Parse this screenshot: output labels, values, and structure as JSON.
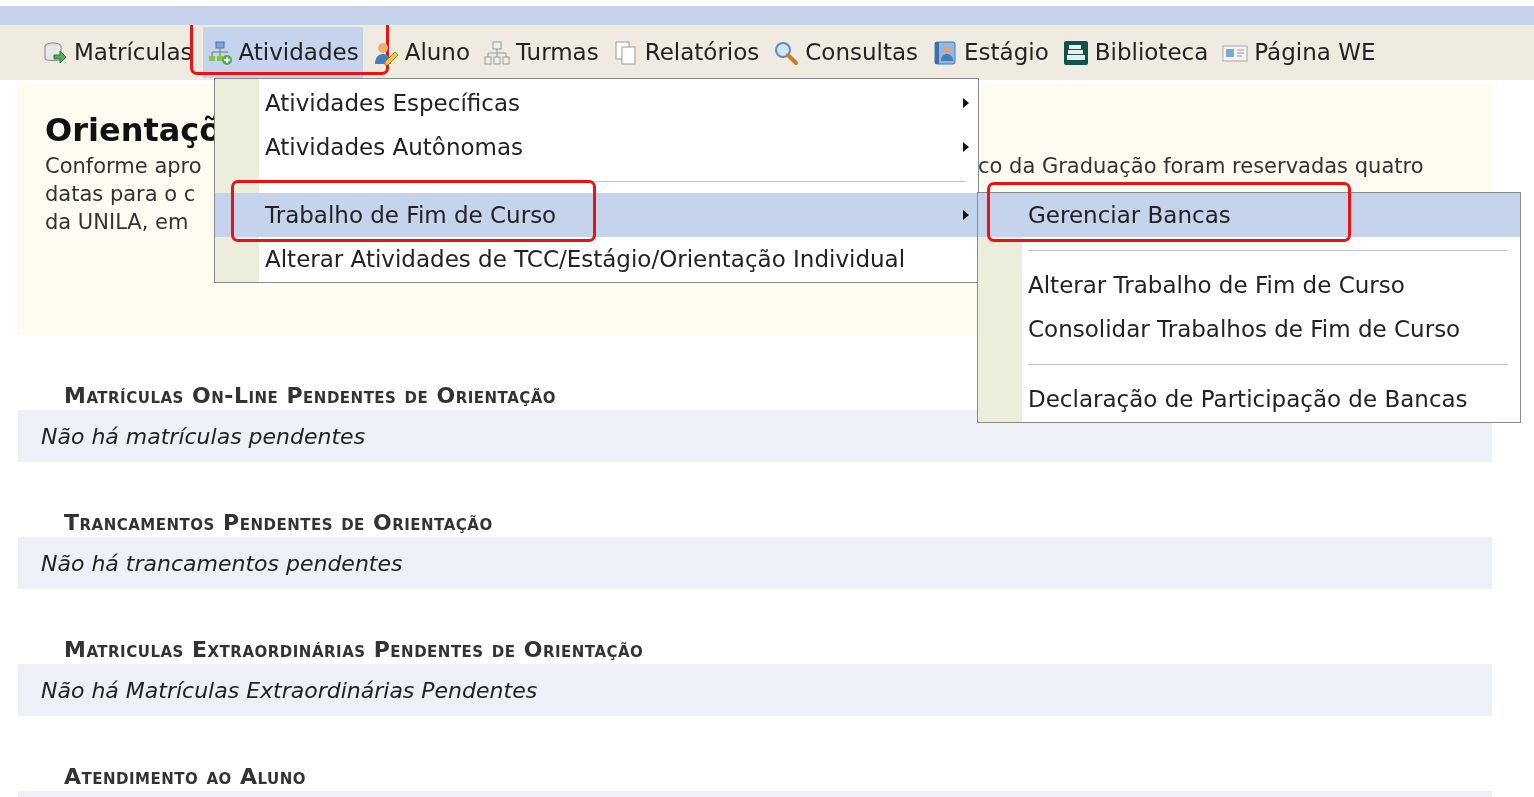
{
  "top_menu": [
    {
      "label": "Matrículas",
      "selected": false,
      "highlighted": false
    },
    {
      "label": "Atividades",
      "selected": true,
      "highlighted": true
    },
    {
      "label": "Aluno",
      "selected": false,
      "highlighted": false
    },
    {
      "label": "Turmas",
      "selected": false,
      "highlighted": false
    },
    {
      "label": "Relatórios",
      "selected": false,
      "highlighted": false
    },
    {
      "label": "Consultas",
      "selected": false,
      "highlighted": false
    },
    {
      "label": "Estágio",
      "selected": false,
      "highlighted": false
    },
    {
      "label": "Biblioteca",
      "selected": false,
      "highlighted": false
    },
    {
      "label": "Página WE",
      "selected": false,
      "highlighted": false
    }
  ],
  "dropdown": {
    "items": [
      {
        "kind": "item",
        "label": "Atividades Específicas",
        "submenu": true,
        "selected": false,
        "highlighted": false
      },
      {
        "kind": "item",
        "label": "Atividades Autônomas",
        "submenu": true,
        "selected": false,
        "highlighted": false
      },
      {
        "kind": "separator"
      },
      {
        "kind": "item",
        "label": "Trabalho de Fim de Curso",
        "submenu": true,
        "selected": true,
        "highlighted": true
      },
      {
        "kind": "item",
        "label": "Alterar Atividades de TCC/Estágio/Orientação Individual",
        "submenu": false,
        "selected": false,
        "highlighted": false
      }
    ]
  },
  "submenu": {
    "items": [
      {
        "kind": "item",
        "label": "Gerenciar Bancas",
        "submenu": false,
        "selected": true,
        "highlighted": true
      },
      {
        "kind": "separator"
      },
      {
        "kind": "item",
        "label": "Alterar Trabalho de Fim de Curso",
        "submenu": false,
        "selected": false,
        "highlighted": false
      },
      {
        "kind": "item",
        "label": "Consolidar Trabalhos de Fim de Curso",
        "submenu": false,
        "selected": false,
        "highlighted": false
      },
      {
        "kind": "separator"
      },
      {
        "kind": "item",
        "label": "Declaração de Participação de Bancas",
        "submenu": false,
        "selected": false,
        "highlighted": false
      }
    ]
  },
  "intro": {
    "title": "Orientaçõ",
    "lines": [
      {
        "left": "Conforme apro",
        "right": "co da Graduação foram reservadas quatro"
      },
      {
        "left": "datas para o c"
      },
      {
        "left": "da UNILA, em"
      }
    ]
  },
  "sections": [
    {
      "heading": "Matrículas On-Line Pendentes de Orientação",
      "message": "Não há matrículas pendentes"
    },
    {
      "heading": "Trancamentos Pendentes de Orientação",
      "message": "Não há trancamentos pendentes"
    },
    {
      "heading": "Matriculas Extraordinárias Pendentes de Orientação",
      "message": "Não há Matrículas Extraordinárias Pendentes"
    },
    {
      "heading": "Atendimento ao Aluno"
    }
  ]
}
